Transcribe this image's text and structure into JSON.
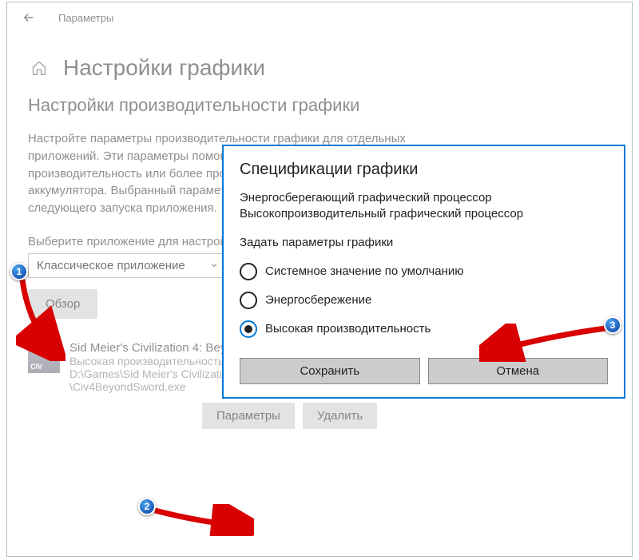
{
  "header": {
    "title": "Параметры"
  },
  "page": {
    "title": "Настройки графики",
    "subtitle": "Настройки производительности графики",
    "description": "Настройте параметры производительности графики для отдельных приложений. Эти параметры помогут обеспечить лучшую производительность или более продолжительное время работы от аккумулятора. Выбранный параметр будет применен только после следующего запуска приложения.",
    "select_label": "Выберите приложение для настройки",
    "dropdown_value": "Классическое приложение",
    "browse_btn": "Обзор"
  },
  "app": {
    "icon_text": "CIV",
    "name": "Sid Meier's Civilization 4: Beyond the Sword",
    "mode": "Высокая производительность",
    "path": "D:\\Games\\Sid Meier's Civilization 4 Complete(full Eng)\\Beyond the Sword\\Civ4BeyondSword.exe",
    "params_btn": "Параметры",
    "delete_btn": "Удалить"
  },
  "dialog": {
    "title": "Спецификации графики",
    "line1": "Энергосберегающий графический процессор",
    "line2": "Высокопроизводительный графический процессор",
    "sub": "Задать параметры графики",
    "options": {
      "default": "Системное значение по умолчанию",
      "power": "Энергосбережение",
      "perf": "Высокая производительность"
    },
    "save": "Сохранить",
    "cancel": "Отмена"
  },
  "callouts": {
    "c1": "1",
    "c2": "2",
    "c3": "3"
  }
}
